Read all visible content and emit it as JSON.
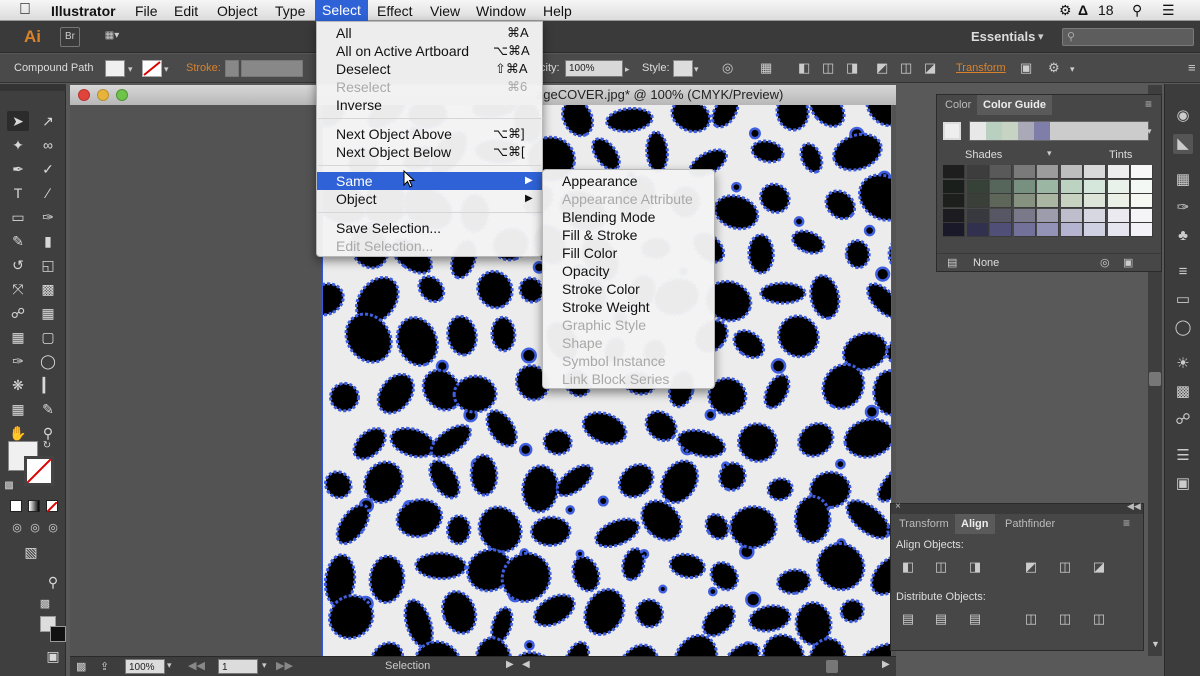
{
  "menubar": {
    "app": "Illustrator",
    "items": [
      "File",
      "Edit",
      "Object",
      "Type",
      "Select",
      "Effect",
      "View",
      "Window",
      "Help"
    ],
    "active": "Select",
    "tray_number": "18"
  },
  "appbar": {
    "logo": "Ai",
    "bridge": "Br",
    "workspace": "Essentials",
    "workspace_arrow": "▾"
  },
  "control": {
    "selection_type": "Compound Path",
    "stroke_label": "Stroke:",
    "opacity_label": "city:",
    "opacity_value": "100%",
    "style_label": "Style:",
    "transform_label": "Transform"
  },
  "document": {
    "title": "ageCOVER.jpg* @ 100% (CMYK/Preview)",
    "zoom": "100%",
    "page": "1",
    "status": "Selection"
  },
  "select_menu": {
    "items": [
      {
        "label": "All",
        "shortcut": "⌘A",
        "enabled": true
      },
      {
        "label": "All on Active Artboard",
        "shortcut": "⌥⌘A",
        "enabled": true
      },
      {
        "label": "Deselect",
        "shortcut": "⇧⌘A",
        "enabled": true
      },
      {
        "label": "Reselect",
        "shortcut": "⌘6",
        "enabled": false
      },
      {
        "label": "Inverse",
        "shortcut": "",
        "enabled": true
      },
      {
        "label": "Next Object Above",
        "shortcut": "⌥⌘]",
        "enabled": true
      },
      {
        "label": "Next Object Below",
        "shortcut": "⌥⌘[",
        "enabled": true
      },
      {
        "label": "Same",
        "shortcut": "",
        "enabled": true,
        "submenu": true,
        "highlighted": true
      },
      {
        "label": "Object",
        "shortcut": "",
        "enabled": true,
        "submenu": true
      },
      {
        "label": "Save Selection...",
        "shortcut": "",
        "enabled": true
      },
      {
        "label": "Edit Selection...",
        "shortcut": "",
        "enabled": false
      }
    ]
  },
  "same_submenu": {
    "items": [
      {
        "label": "Appearance",
        "enabled": true
      },
      {
        "label": "Appearance Attribute",
        "enabled": false
      },
      {
        "label": "Blending Mode",
        "enabled": true
      },
      {
        "label": "Fill & Stroke",
        "enabled": true
      },
      {
        "label": "Fill Color",
        "enabled": true
      },
      {
        "label": "Opacity",
        "enabled": true
      },
      {
        "label": "Stroke Color",
        "enabled": true
      },
      {
        "label": "Stroke Weight",
        "enabled": true
      },
      {
        "label": "Graphic Style",
        "enabled": false
      },
      {
        "label": "Shape",
        "enabled": false
      },
      {
        "label": "Symbol Instance",
        "enabled": false
      },
      {
        "label": "Link Block Series",
        "enabled": false
      }
    ]
  },
  "color_guide": {
    "tabs": [
      "Color",
      "Color Guide"
    ],
    "active_tab": "Color Guide",
    "shades_label": "Shades",
    "tints_label": "Tints",
    "footer_label": "None",
    "harmony_colors": [
      "#e8e8e8",
      "#b9cfc0",
      "#c7d4c4",
      "#a9a9b8",
      "#7e7ea8"
    ],
    "grid_colors": [
      [
        "#1e1e1e",
        "#3d3d3d",
        "#595959",
        "#7a7a7a",
        "#9c9c9c",
        "#bdbdbd",
        "#d9d9d9",
        "#eeeeee",
        "#f7f7f7"
      ],
      [
        "#1b1f1c",
        "#364138",
        "#56665a",
        "#789080",
        "#9bb6a3",
        "#bcd3c2",
        "#d5e6da",
        "#e8f1ea",
        "#f3f8f4"
      ],
      [
        "#1d1f1c",
        "#3a4038",
        "#5e665a",
        "#87917f",
        "#aab5a2",
        "#c8d2c1",
        "#dde5d8",
        "#ecf1e8",
        "#f6f8f3"
      ],
      [
        "#1c1c20",
        "#38383f",
        "#565664",
        "#797989",
        "#9c9cad",
        "#bdbdcb",
        "#d7d7e1",
        "#eaeaf0",
        "#f5f5f8"
      ],
      [
        "#19192a",
        "#31314f",
        "#4f4f77",
        "#71719a",
        "#9393b8",
        "#b4b4d0",
        "#d0d0e3",
        "#e5e5f0",
        "#f2f2f8"
      ]
    ]
  },
  "align_panel": {
    "tabs": [
      "Transform",
      "Align",
      "Pathfinder"
    ],
    "active_tab": "Align",
    "align_objects_label": "Align Objects:",
    "distribute_objects_label": "Distribute Objects:"
  },
  "colors": {
    "accent": "#2f62d6",
    "selection_blue": "#3f5fe0"
  }
}
